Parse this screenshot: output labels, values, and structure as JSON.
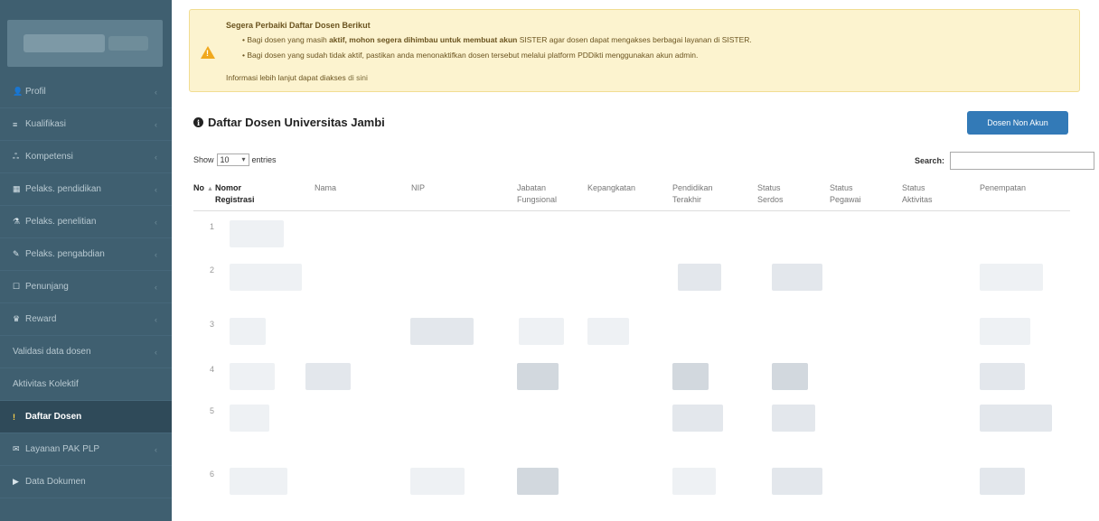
{
  "sidebar": {
    "items": [
      {
        "icon": "user-icon",
        "glyph": "👤",
        "label": "Profil",
        "chev": true
      },
      {
        "icon": "graduation-icon",
        "glyph": "≡",
        "label": "Kualifikasi",
        "chev": true
      },
      {
        "icon": "users-icon",
        "glyph": "ஃ",
        "label": "Kompetensi",
        "chev": true
      },
      {
        "icon": "book-icon",
        "glyph": "▦",
        "label": "Pelaks. pendidikan",
        "chev": true
      },
      {
        "icon": "flask-icon",
        "glyph": "⚗",
        "label": "Pelaks. penelitian",
        "chev": true
      },
      {
        "icon": "hands-icon",
        "glyph": "✎",
        "label": "Pelaks. pengabdian",
        "chev": true
      },
      {
        "icon": "support-icon",
        "glyph": "☐",
        "label": "Penunjang",
        "chev": true
      },
      {
        "icon": "trophy-icon",
        "glyph": "♛",
        "label": "Reward",
        "chev": true
      },
      {
        "icon": "",
        "glyph": "",
        "label": "Validasi data dosen",
        "chev": true
      },
      {
        "icon": "",
        "glyph": "",
        "label": "Aktivitas Kolektif",
        "chev": false
      },
      {
        "icon": "lecturer-icon",
        "glyph": "!",
        "label": "Daftar Dosen",
        "chev": false,
        "active": true
      },
      {
        "icon": "service-icon",
        "glyph": "✉",
        "label": "Layanan PAK PLP",
        "chev": true
      },
      {
        "icon": "folder-icon",
        "glyph": "▶",
        "label": "Data Dokumen",
        "chev": false
      }
    ]
  },
  "alert": {
    "title": "Segera Perbaiki Daftar Dosen Berikut",
    "line1_prefix": "Bagi dosen yang masih ",
    "line1_bold": "aktif, mohon segera dihimbau untuk membuat akun",
    "line1_suffix": " SISTER agar dosen dapat mengakses berbagai layanan di SISTER.",
    "line2": "Bagi dosen yang sudah tidak aktif, pastikan anda menonaktifkan dosen tersebut melalui platform PDDikti menggunakan akun admin.",
    "info_prefix": "Informasi lebih lanjut dapat diakses ",
    "info_link": "di sini"
  },
  "main": {
    "title": "Daftar Dosen Universitas Jambi",
    "action_button": "Dosen Non Akun",
    "show_label": "Show",
    "show_value": "10",
    "entries_label": "entries",
    "search_label": "Search:"
  },
  "table": {
    "headers": [
      {
        "l1": "No",
        "l2": "",
        "bold": true,
        "sort": "▲"
      },
      {
        "l1": "Nomor",
        "l2": "Registrasi",
        "bold": true,
        "sort": ""
      },
      {
        "l1": "Nama",
        "l2": "",
        "bold": false,
        "sort": ""
      },
      {
        "l1": "NIP",
        "l2": "",
        "bold": false,
        "sort": ""
      },
      {
        "l1": "Jabatan",
        "l2": "Fungsional",
        "bold": false,
        "sort": ""
      },
      {
        "l1": "Kepangkatan",
        "l2": "",
        "bold": false,
        "sort": ""
      },
      {
        "l1": "Pendidikan",
        "l2": "Terakhir",
        "bold": false,
        "sort": ""
      },
      {
        "l1": "Status",
        "l2": "Serdos",
        "bold": false,
        "sort": ""
      },
      {
        "l1": "Status",
        "l2": "Pegawai",
        "bold": false,
        "sort": ""
      },
      {
        "l1": "Status",
        "l2": "Aktivitas",
        "bold": false,
        "sort": ""
      },
      {
        "l1": "Penempatan",
        "l2": "",
        "bold": false,
        "sort": ""
      }
    ],
    "row_numbers": [
      "1",
      "2",
      "3",
      "4",
      "5",
      "6"
    ]
  }
}
